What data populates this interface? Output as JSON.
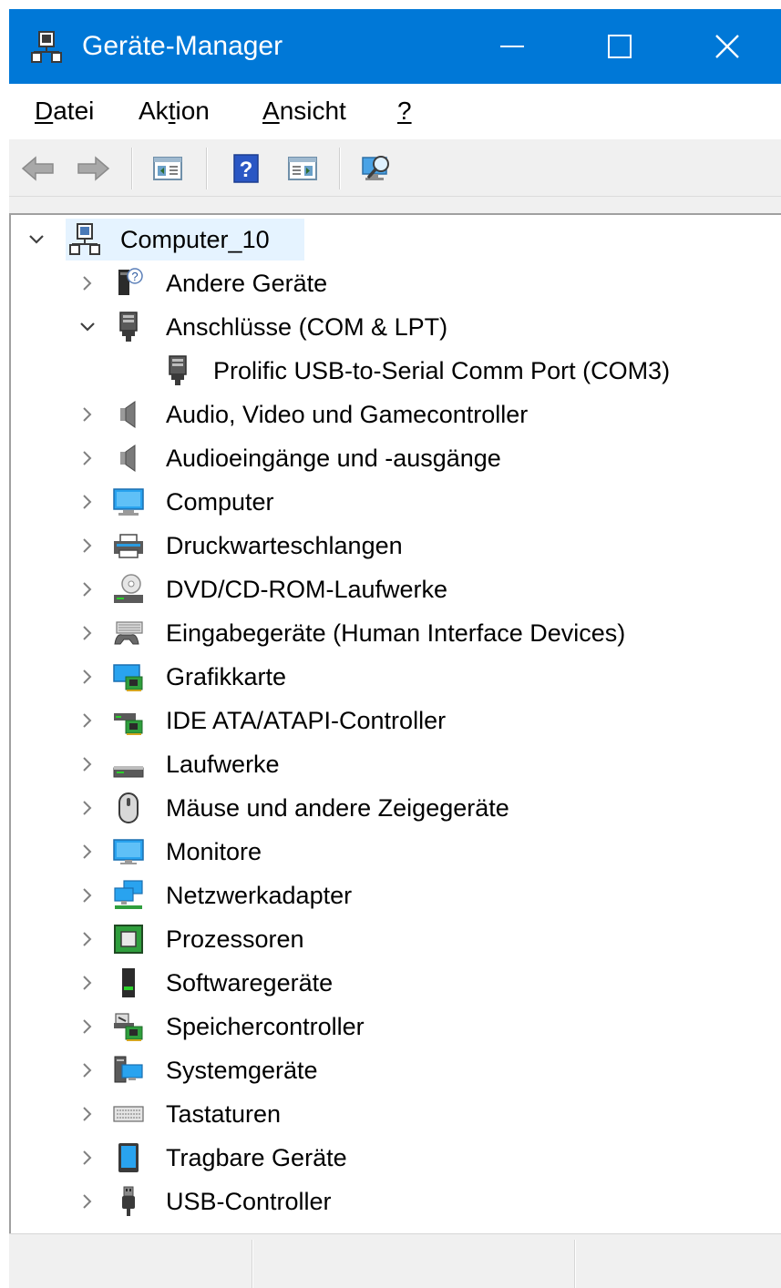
{
  "window": {
    "title": "Geräte-Manager",
    "title_bar_color": "#0078d7",
    "icon": "computer-network-icon"
  },
  "menu": {
    "items": [
      {
        "label_ul": "D",
        "label_rest": "atei"
      },
      {
        "label_pre": "Ak",
        "label_ul": "t",
        "label_rest": "ion"
      },
      {
        "label_ul": "A",
        "label_rest": "nsicht"
      },
      {
        "label_ul": "?",
        "label_rest": ""
      }
    ]
  },
  "toolbar": {
    "buttons": [
      "back-icon",
      "forward-icon",
      "show-hide-console-tree-icon",
      "help-icon",
      "action-pane-icon",
      "scan-hardware-icon"
    ]
  },
  "tree": {
    "root": {
      "label": "Computer_10",
      "expanded": true,
      "selected": true
    },
    "categories": [
      {
        "label": "Andere Geräte",
        "icon": "unknown-device-icon",
        "expanded": false
      },
      {
        "label": "Anschlüsse (COM & LPT)",
        "icon": "port-icon",
        "expanded": true,
        "children": [
          {
            "label": "Prolific USB-to-Serial Comm Port (COM3)",
            "icon": "port-icon"
          }
        ]
      },
      {
        "label": "Audio, Video und Gamecontroller",
        "icon": "speaker-icon",
        "expanded": false
      },
      {
        "label": "Audioeingänge und -ausgänge",
        "icon": "speaker-icon",
        "expanded": false
      },
      {
        "label": "Computer",
        "icon": "computer-monitor-icon",
        "expanded": false
      },
      {
        "label": "Druckwarteschlangen",
        "icon": "printer-icon",
        "expanded": false
      },
      {
        "label": "DVD/CD-ROM-Laufwerke",
        "icon": "dvd-drive-icon",
        "expanded": false
      },
      {
        "label": "Eingabegeräte (Human Interface Devices)",
        "icon": "hid-icon",
        "expanded": false
      },
      {
        "label": "Grafikkarte",
        "icon": "display-adapter-icon",
        "expanded": false
      },
      {
        "label": "IDE ATA/ATAPI-Controller",
        "icon": "ide-controller-icon",
        "expanded": false
      },
      {
        "label": "Laufwerke",
        "icon": "disk-drive-icon",
        "expanded": false
      },
      {
        "label": "Mäuse und andere Zeigegeräte",
        "icon": "mouse-icon",
        "expanded": false
      },
      {
        "label": "Monitore",
        "icon": "monitor-icon",
        "expanded": false
      },
      {
        "label": "Netzwerkadapter",
        "icon": "network-adapter-icon",
        "expanded": false
      },
      {
        "label": "Prozessoren",
        "icon": "processor-icon",
        "expanded": false
      },
      {
        "label": "Softwaregeräte",
        "icon": "software-device-icon",
        "expanded": false
      },
      {
        "label": "Speichercontroller",
        "icon": "storage-controller-icon",
        "expanded": false
      },
      {
        "label": "Systemgeräte",
        "icon": "system-devices-icon",
        "expanded": false
      },
      {
        "label": "Tastaturen",
        "icon": "keyboard-icon",
        "expanded": false
      },
      {
        "label": "Tragbare Geräte",
        "icon": "portable-device-icon",
        "expanded": false
      },
      {
        "label": "USB-Controller",
        "icon": "usb-icon",
        "expanded": false
      }
    ]
  }
}
